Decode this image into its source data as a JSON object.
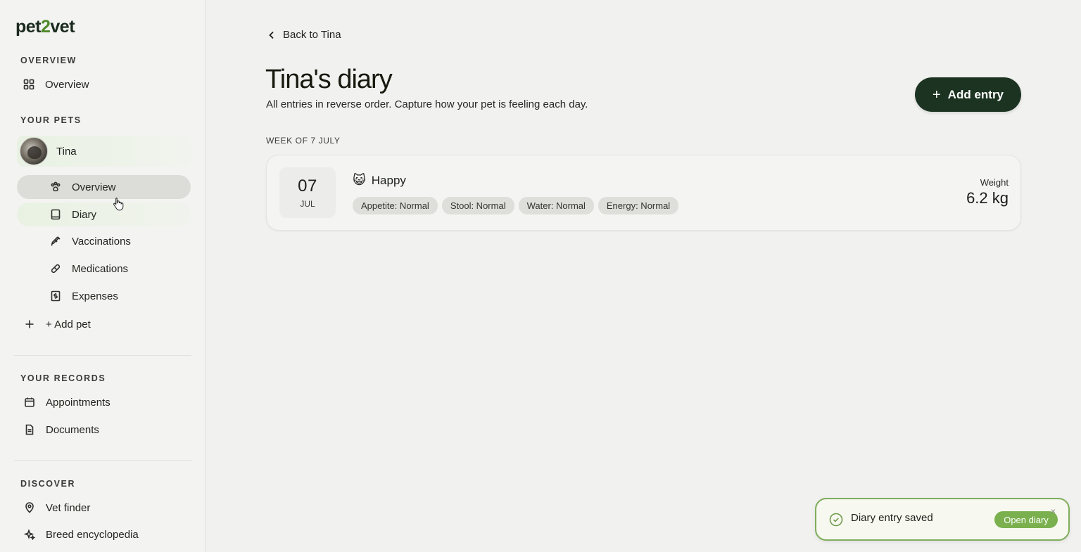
{
  "brand": {
    "logo_left": "pet",
    "logo_mid": "2",
    "logo_right": "vet"
  },
  "sidebar": {
    "overview_section": {
      "label": "OVERVIEW",
      "items": [
        {
          "label": "Overview",
          "icon": "grid-icon"
        }
      ]
    },
    "pets_section": {
      "label": "YOUR PETS",
      "pet": {
        "name": "Tina"
      },
      "pet_items": [
        {
          "label": "Overview",
          "icon": "paw-icon",
          "active": true
        },
        {
          "label": "Diary",
          "icon": "book-icon"
        },
        {
          "label": "Vaccinations",
          "icon": "syringe-icon"
        },
        {
          "label": "Medications",
          "icon": "pill-icon"
        },
        {
          "label": "Expenses",
          "icon": "receipt-icon"
        }
      ],
      "add_pet": "+ Add pet"
    },
    "records_section": {
      "label": "YOUR RECORDS",
      "items": [
        {
          "label": "Appointments",
          "icon": "calendar-icon"
        },
        {
          "label": "Documents",
          "icon": "document-icon"
        }
      ]
    },
    "discover_section": {
      "label": "DISCOVER",
      "items": [
        {
          "label": "Vet finder",
          "icon": "location-pin-icon"
        },
        {
          "label": "Breed encyclopedia",
          "icon": "sparkle-icon"
        }
      ]
    }
  },
  "main": {
    "back_link": "Back to Tina",
    "title": "Tina's diary",
    "subtitle": "All entries in reverse order. Capture how your pet is feeling each day.",
    "add_entry_label": "Add entry",
    "week_label": "WEEK OF 7 JULY",
    "entries": [
      {
        "day": "07",
        "month": "JUL",
        "mood_emoji": "😺",
        "mood": "Happy",
        "tags": [
          "Appetite: Normal",
          "Stool: Normal",
          "Water: Normal",
          "Energy: Normal"
        ],
        "weight_label": "Weight",
        "weight_value": "6.2 kg"
      }
    ]
  },
  "toast": {
    "message": "Diary entry saved",
    "action_label": "Open diary",
    "close_glyph": "×"
  },
  "colors": {
    "primary_dark": "#1c3322",
    "accent_green": "#7ab04e",
    "toast_border": "#7fae5c"
  }
}
